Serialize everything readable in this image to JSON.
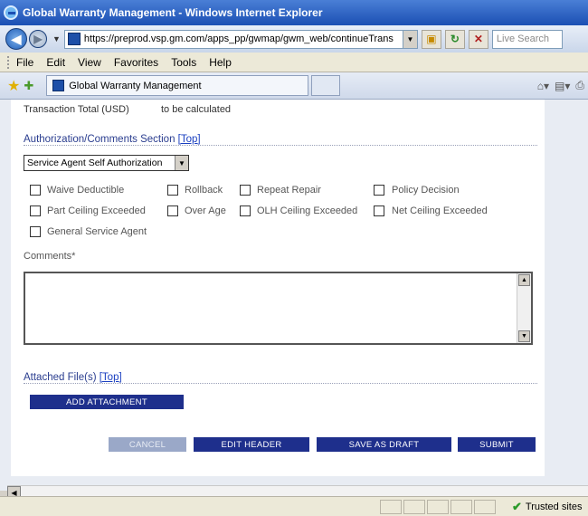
{
  "window": {
    "title": "Global Warranty Management - Windows Internet Explorer"
  },
  "address": {
    "url": "https://preprod.vsp.gm.com/apps_pp/gwmap/gwm_web/continueTrans",
    "search_placeholder": "Live Search"
  },
  "menu": [
    "File",
    "Edit",
    "View",
    "Favorites",
    "Tools",
    "Help"
  ],
  "tab": {
    "label": "Global Warranty Management"
  },
  "page": {
    "transaction_label": "Transaction Total (USD)",
    "transaction_value": "to be calculated",
    "auth_section": "Authorization/Comments Section",
    "top_link": "[Top]",
    "auth_select": "Service Agent Self Authorization",
    "checkboxes": {
      "waive": "Waive Deductible",
      "rollback": "Rollback",
      "repeat": "Repeat Repair",
      "policy": "Policy Decision",
      "part_ceiling": "Part Ceiling Exceeded",
      "over_age": "Over Age",
      "olh_ceiling": "OLH Ceiling Exceeded",
      "net_ceiling": "Net Ceiling Exceeded",
      "general_agent": "General Service Agent"
    },
    "comments_label": "Comments*",
    "attached_label": "Attached File(s)",
    "add_attachment": "ADD ATTACHMENT",
    "cancel": "CANCEL",
    "edit_header": "EDIT HEADER",
    "save_draft": "SAVE AS DRAFT",
    "submit": "SUBMIT"
  },
  "status": {
    "zone": "Trusted sites"
  },
  "colors": {
    "button_dark": "#1e2f8c",
    "button_disabled": "#9aa8c8",
    "section_header": "#2a3d8f"
  }
}
